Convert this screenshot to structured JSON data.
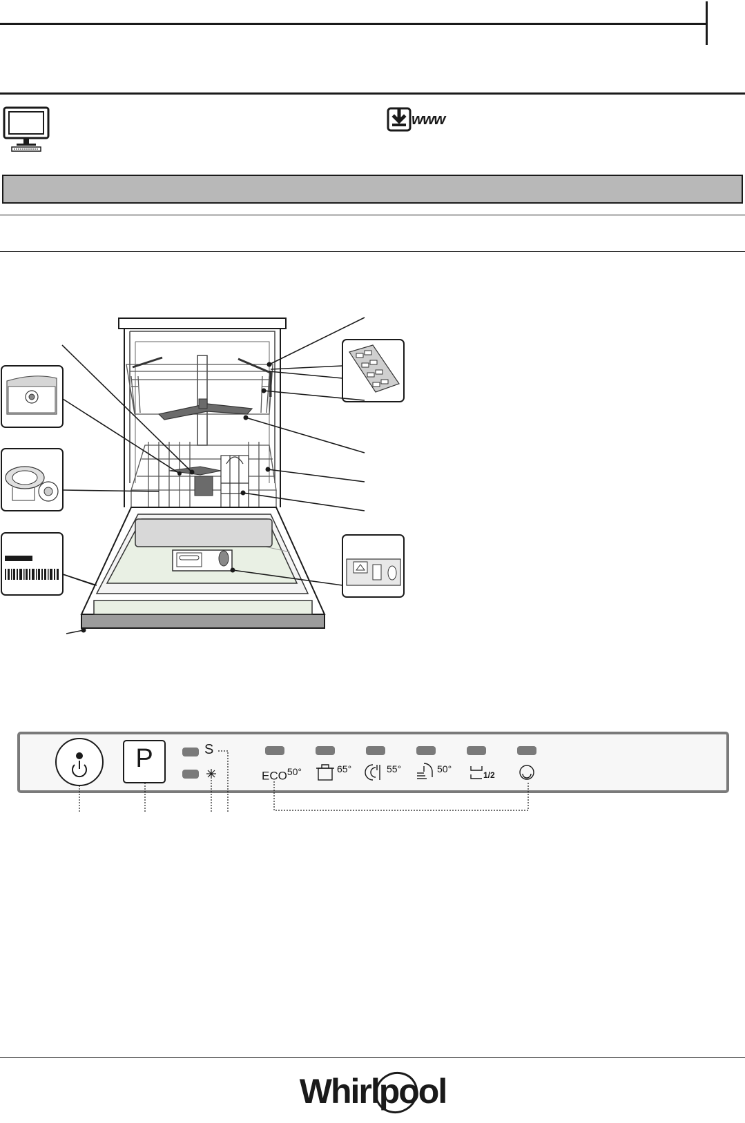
{
  "header": {
    "computer_icon": "computer-monitor-icon",
    "download_icon": "download-arrow-icon",
    "download_text": "www"
  },
  "control_panel": {
    "power_icon": "power-icon",
    "program_button_label": "P",
    "salt_indicator_label": "S",
    "rinse_aid_icon": "rinse-aid-icon",
    "programs": [
      {
        "name": "eco",
        "label": "ECO",
        "temperature": "50°"
      },
      {
        "name": "intensive",
        "icon": "pot-icon",
        "temperature": "65°"
      },
      {
        "name": "daily",
        "icon": "plate-cutlery-icon",
        "temperature": "55°"
      },
      {
        "name": "quick",
        "icon": "quick-wash-icon",
        "temperature": "50°"
      },
      {
        "name": "half-load",
        "icon": "half-load-icon",
        "temperature": "1/2"
      },
      {
        "name": "prewash",
        "icon": "prewash-icon",
        "temperature": ""
      }
    ]
  },
  "footer": {
    "brand": "Whirlpool"
  },
  "colors": {
    "line": "#1a1a1a",
    "gray_band": "#b8b8b8",
    "led": "#7a7a7a",
    "panel_bg": "#f7f7f7",
    "cavity_gray": "#9c9c9c",
    "inner_door": "#e9f0e4"
  }
}
